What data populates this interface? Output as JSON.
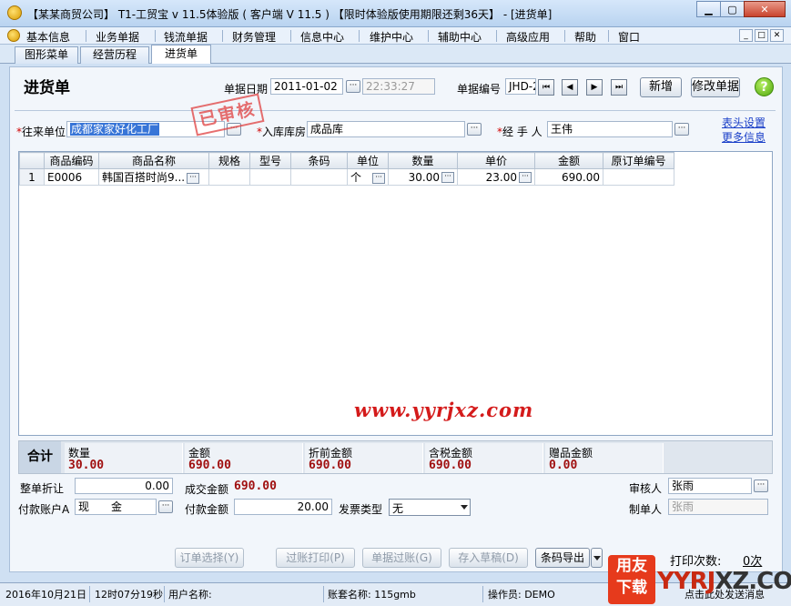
{
  "window": {
    "title": "【某某商贸公司】 T1-工贸宝 v 11.5体验版 ( 客户端 V 11.5 ) 【限时体验版使用期限还剩36天】 - [进货单]",
    "min": "▁",
    "max": "▢",
    "close": "✕"
  },
  "menu": [
    "基本信息",
    "业务单据",
    "钱流单据",
    "财务管理",
    "信息中心",
    "维护中心",
    "辅助中心",
    "高级应用",
    "帮助",
    "窗口"
  ],
  "mdi": {
    "min": "_",
    "restore": "□",
    "close": "✕"
  },
  "tabs": [
    "图形菜单",
    "经营历程",
    "进货单"
  ],
  "header": {
    "title": "进货单",
    "date_label": "单据日期",
    "date_value": "2011-01-02",
    "time_value": "22:33:27",
    "no_label": "单据编号",
    "no_value": "JHD-2",
    "nav": {
      "first": "⏮",
      "prev": "◀",
      "next": "▶",
      "last": "⏭"
    },
    "new_button": "新增",
    "edit_button": "修改单据",
    "help": "?"
  },
  "form": {
    "req": "*",
    "partner_label": "往来单位",
    "partner_value": "成都家家好化工厂",
    "stamp": "已审核",
    "warehouse_label": "入库库房",
    "warehouse_value": "成品库",
    "handler_label": "经 手 人",
    "handler_value": "王伟",
    "header_settings_link": "表头设置",
    "more_info_link": "更多信息",
    "ellipsis": "···"
  },
  "grid": {
    "columns": [
      "",
      "商品编码",
      "商品名称",
      "规格",
      "型号",
      "条码",
      "单位",
      "数量",
      "单价",
      "金额",
      "原订单编号"
    ],
    "rows": [
      {
        "no": "1",
        "code": "E0006",
        "name": "韩国百搭时尚9...",
        "spec": "",
        "model": "",
        "barcode": "",
        "unit": "个",
        "qty": "30.00",
        "price": "23.00",
        "amount": "690.00",
        "orig": ""
      }
    ]
  },
  "watermark": "www.yyrjxz.com",
  "totals": {
    "label": "合计",
    "items": [
      {
        "label": "数量",
        "value": "30.00"
      },
      {
        "label": "金额",
        "value": "690.00"
      },
      {
        "label": "折前金额",
        "value": "690.00"
      },
      {
        "label": "含税金额",
        "value": "690.00"
      },
      {
        "label": "赠品金额",
        "value": "0.00"
      }
    ]
  },
  "bottom": {
    "discount_label": "整单折让",
    "discount_value": "0.00",
    "deal_label": "成交金额",
    "deal_value": "690.00",
    "auditor_label": "审核人",
    "auditor_value": "张雨",
    "account_label": "付款账户A",
    "account_value": "现　　金",
    "pay_label": "付款金额",
    "pay_value": "20.00",
    "invoice_label": "发票类型",
    "invoice_value": "无",
    "maker_label": "制单人",
    "maker_value": "张雨"
  },
  "actions": {
    "order_select": "订单选择(Y)",
    "post_print": "过账打印(P)",
    "post": "单据过账(G)",
    "save_draft": "存入草稿(D)",
    "barcode_export": "条码导出",
    "print_label": "打印次数:",
    "print_count": "0次"
  },
  "status": {
    "date": "2016年10月21日",
    "time": "12时07分19秒",
    "user_label": "用户名称:",
    "set_label": "账套名称: 115gmb",
    "operator_label": "操作员: DEMO",
    "note": "点击此处发送消息"
  },
  "logo": {
    "badge_top": "用友",
    "badge_bottom": "下载",
    "site_a": "YYRJ",
    "site_b": "XZ.COM"
  }
}
